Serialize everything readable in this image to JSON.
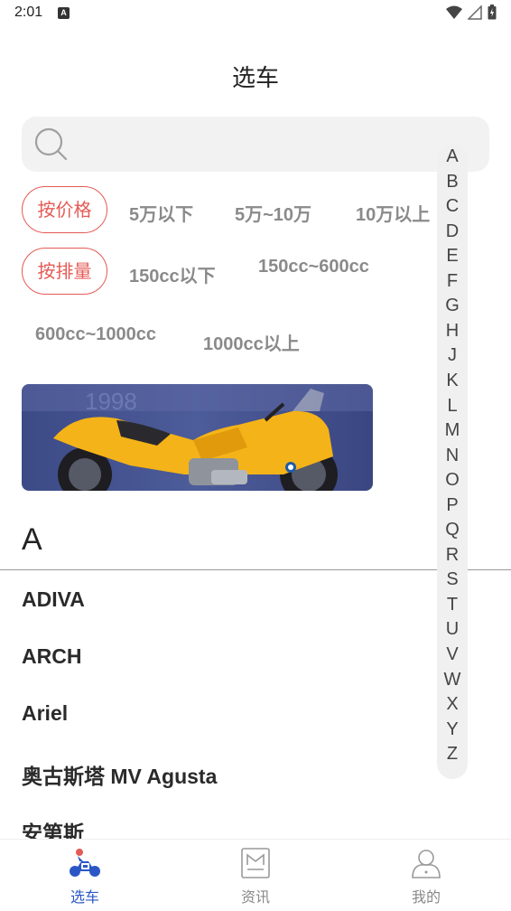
{
  "status_bar": {
    "time": "2:01",
    "notification_badge": "A"
  },
  "header": {
    "title": "选车"
  },
  "search": {
    "placeholder": "",
    "value": ""
  },
  "filters": {
    "price": {
      "label": "按价格",
      "options": [
        "5万以下",
        "5万~10万",
        "10万以上"
      ]
    },
    "displacement": {
      "label": "按排量",
      "options": [
        "150cc以下",
        "150cc~600cc",
        "600cc~1000cc",
        "1000cc以上"
      ]
    }
  },
  "banner": {
    "image": "yellow-motorcycle-photo"
  },
  "section": {
    "letter": "A",
    "brands": [
      "ADIVA",
      "ARCH",
      "Ariel",
      "奥古斯塔 MV Agusta",
      "安第斯"
    ]
  },
  "alphabet": [
    "A",
    "B",
    "C",
    "D",
    "E",
    "F",
    "G",
    "H",
    "J",
    "K",
    "L",
    "M",
    "N",
    "O",
    "P",
    "Q",
    "R",
    "S",
    "T",
    "U",
    "V",
    "W",
    "X",
    "Y",
    "Z"
  ],
  "bottom_nav": {
    "items": [
      {
        "label": "选车",
        "icon": "motorcycle-icon",
        "active": true
      },
      {
        "label": "资讯",
        "icon": "news-icon",
        "active": false
      },
      {
        "label": "我的",
        "icon": "profile-icon",
        "active": false
      }
    ]
  },
  "colors": {
    "accent": "#e45a55",
    "active_nav": "#2b57c6",
    "index_bg": "#f0f0f0",
    "search_bg": "#f2f2f2"
  }
}
